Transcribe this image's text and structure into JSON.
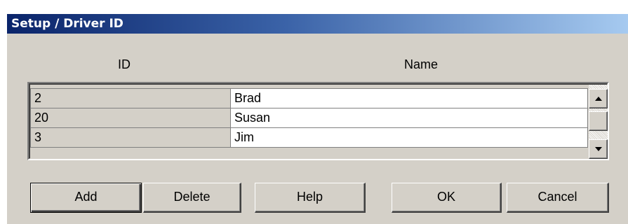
{
  "window": {
    "title": "Setup / Driver ID"
  },
  "columns": {
    "id": "ID",
    "name": "Name"
  },
  "rows": [
    {
      "id": "2",
      "name": "Brad"
    },
    {
      "id": "20",
      "name": "Susan"
    },
    {
      "id": "3",
      "name": "Jim"
    }
  ],
  "buttons": {
    "add": "Add",
    "delete": "Delete",
    "help": "Help",
    "ok": "OK",
    "cancel": "Cancel"
  },
  "colors": {
    "title_gradient_start": "#0a246a",
    "title_gradient_end": "#a6caf0",
    "dialog_face": "#d4d0c8"
  }
}
